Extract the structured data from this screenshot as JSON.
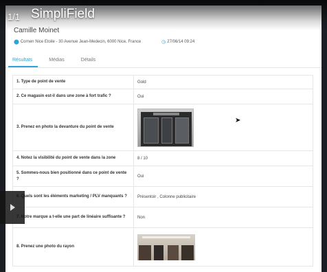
{
  "overlay": {
    "counter": "1/1",
    "title": "SimpliField"
  },
  "visit": {
    "person": "Camille Moinet",
    "location": "Cornen Nice Etoile - 30 Avenue Jean-Medecin, 6000 Nice, France",
    "datetime": "27/06/14 09:24"
  },
  "tabs": [
    {
      "label": "Résultats",
      "active": true
    },
    {
      "label": "Médias",
      "active": false
    },
    {
      "label": "Détails",
      "active": false
    }
  ],
  "rows": [
    {
      "question": "1. Type de point de vente",
      "answer": "Gold"
    },
    {
      "question": "2. Ce magasin est-il dans une zone à fort trafic ?",
      "answer": "Oui"
    },
    {
      "question": "3. Prenez en photo la devanture du point de vente",
      "answer": ""
    },
    {
      "question": "4. Notez la visibilité du point de vente dans la zone",
      "answer": "8 / 10"
    },
    {
      "question": "5. Sommes-nous bien positionné dans ce point de vente ?",
      "answer": "Oui"
    },
    {
      "question": "6. Quels sont les éléments marketing / PLV manquants ?",
      "answer": "Présentoir , Colonne publicitaire"
    },
    {
      "question": "7. Notre marque a t-elle une part de linéaire suffisante ?",
      "answer": "Non"
    },
    {
      "question": "8. Prenez une photo du rayon",
      "answer": ""
    }
  ],
  "colors": {
    "accent": "#2ea3d8"
  },
  "icons": {
    "location": "map-pin-icon",
    "time": "clock-icon",
    "video": "play-icon"
  }
}
